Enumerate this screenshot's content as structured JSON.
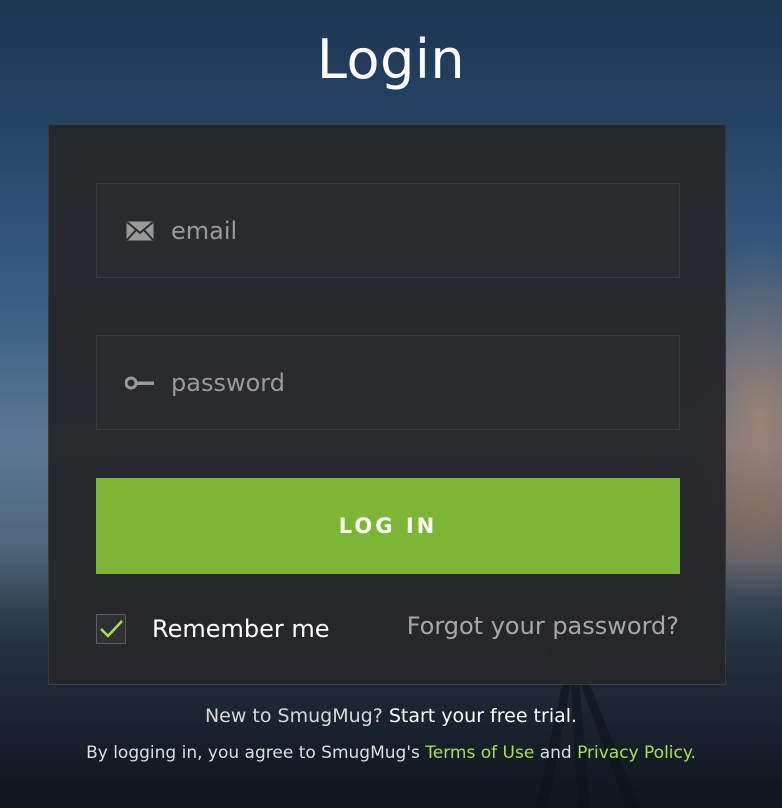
{
  "page": {
    "title": "Login"
  },
  "form": {
    "email": {
      "value": "",
      "placeholder": "email",
      "icon": "envelope-icon"
    },
    "password": {
      "value": "",
      "placeholder": "password",
      "icon": "key-icon"
    },
    "login_button_label": "LOG IN",
    "remember_me": {
      "label": "Remember me",
      "checked": true
    },
    "forgot_password_link": "Forgot your password?"
  },
  "footer": {
    "signup_prompt": "New to SmugMug?",
    "signup_link": "Start your free trial.",
    "legal_prefix": "By logging in, you agree to SmugMug's",
    "terms_link": "Terms of Use",
    "legal_and": "and",
    "privacy_link": "Privacy Policy."
  },
  "colors": {
    "accent": "#7db635",
    "link_accent": "#a6e04a",
    "panel": "#26272a"
  }
}
